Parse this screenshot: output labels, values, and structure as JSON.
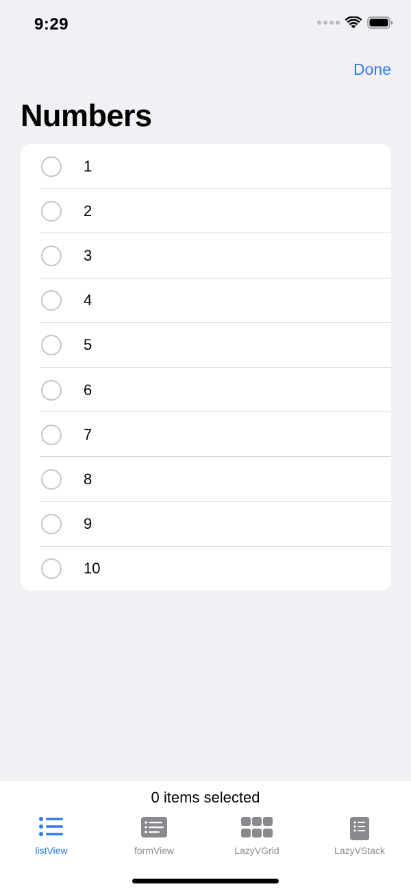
{
  "status_bar": {
    "time": "9:29",
    "icons": [
      "signal-dots-icon",
      "wifi-icon",
      "battery-icon"
    ]
  },
  "nav": {
    "done_label": "Done",
    "title": "Numbers"
  },
  "list": {
    "items": [
      {
        "label": "1",
        "selected": false
      },
      {
        "label": "2",
        "selected": false
      },
      {
        "label": "3",
        "selected": false
      },
      {
        "label": "4",
        "selected": false
      },
      {
        "label": "5",
        "selected": false
      },
      {
        "label": "6",
        "selected": false
      },
      {
        "label": "7",
        "selected": false
      },
      {
        "label": "8",
        "selected": false
      },
      {
        "label": "9",
        "selected": false
      },
      {
        "label": "10",
        "selected": false
      }
    ]
  },
  "toolbar": {
    "selection_text": "0 items selected"
  },
  "tabs": [
    {
      "label": "listView",
      "icon": "list-bullet-icon",
      "active": true
    },
    {
      "label": "formView",
      "icon": "form-list-icon",
      "active": false
    },
    {
      "label": "LazyVGrid",
      "icon": "grid-icon",
      "active": false
    },
    {
      "label": "LazyVStack",
      "icon": "doc-list-icon",
      "active": false
    }
  ],
  "colors": {
    "accent": "#2f7be5",
    "background": "#f1f0f5",
    "inactive_tab": "#8a8a8e"
  }
}
